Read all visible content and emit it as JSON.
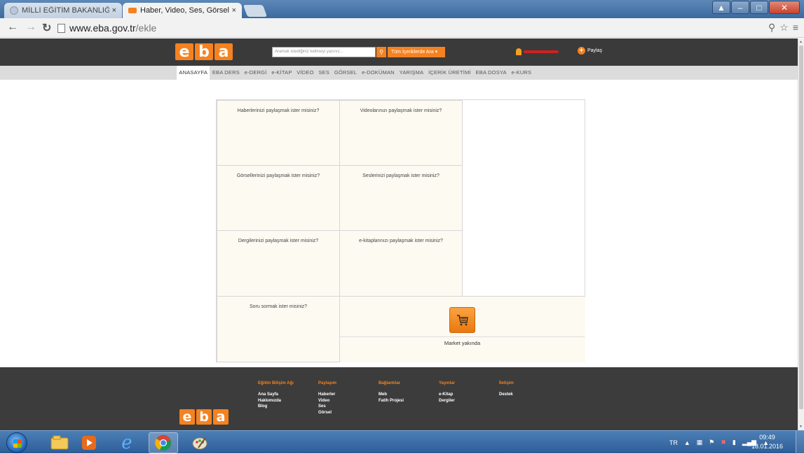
{
  "browser": {
    "tabs": [
      {
        "title": "MİLLİ EĞİTİM BAKANLIĞI |",
        "active": false,
        "close": "×"
      },
      {
        "title": "Haber, Video, Ses, Görsel |",
        "active": true,
        "close": "×"
      }
    ],
    "url_host": "www.eba.gov.tr",
    "url_path": "/ekle"
  },
  "header": {
    "logo_letters": [
      "e",
      "b",
      "a"
    ],
    "search_placeholder": "Aramak istediğiniz kelimeyi yazınız...",
    "search_scope": "Tüm İçeriklerde Ara",
    "share_label": "Paylaş"
  },
  "menu": [
    "ANASAYFA",
    "EBA DERS",
    "e-DERGİ",
    "e-KİTAP",
    "VİDEO",
    "SES",
    "GÖRSEL",
    "e-DOKÜMAN",
    "YARIŞMA",
    "İÇERİK ÜRETİMİ",
    "EBA DOSYA",
    "e-KURS"
  ],
  "cells": [
    "Haberlerinizi paylaşmak ister misiniz?",
    "Videolarınızı paylaşmak ister misiniz?",
    "Görsellerinizi paylaşmak ister misiniz?",
    "Seslerinizi paylaşmak ister misiniz?",
    "Dergilerinizi paylaşmak ister misiniz?",
    "e-kitaplarınızı paylaşmak ister misiniz?",
    "Soru sormak ister misiniz?"
  ],
  "market_label": "Market yakında",
  "footer": {
    "columns": [
      {
        "heading": "Eğitim Bilişim Ağı",
        "items": [
          "Ana Sayfa",
          "Hakkımızda",
          "Blog"
        ]
      },
      {
        "heading": "Paylaşım",
        "items": [
          "Haberler",
          "Video",
          "Ses",
          "Görsel"
        ]
      },
      {
        "heading": "Bağlantılar",
        "items": [
          "Meb",
          "Fatih Projesi"
        ]
      },
      {
        "heading": "Yayınlar",
        "items": [
          "e-Kitap",
          "Dergiler"
        ]
      },
      {
        "heading": "İletişim",
        "items": [
          "Destek"
        ]
      }
    ]
  },
  "taskbar": {
    "lang": "TR",
    "time": "09:49",
    "date": "18.01.2016"
  },
  "colors": {
    "brand_orange": "#f58220",
    "header_dark": "#3a3a3a",
    "cell_bg": "#fdfaf2"
  }
}
